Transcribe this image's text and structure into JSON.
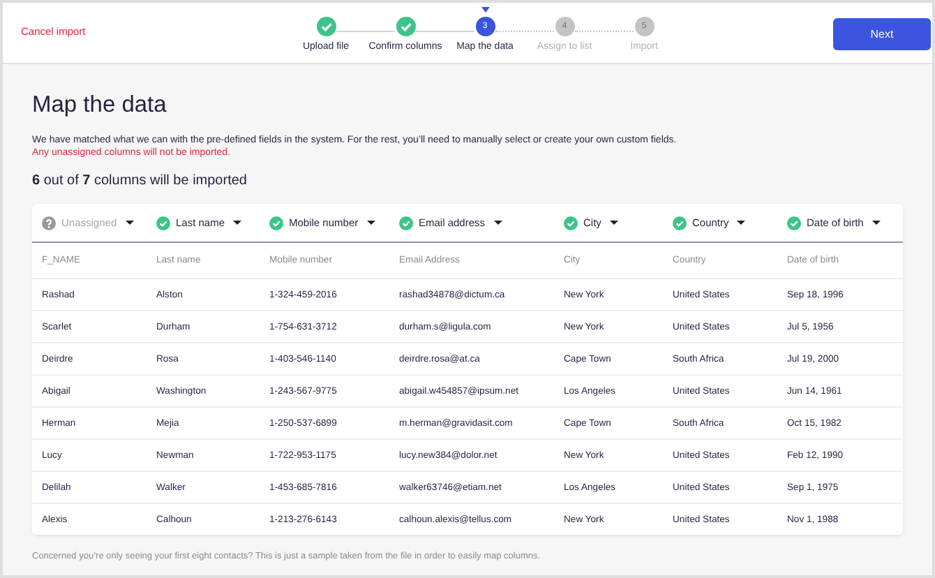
{
  "header": {
    "cancel": "Cancel import",
    "next": "Next",
    "steps": [
      {
        "label": "Upload file",
        "completed": true,
        "selected": false
      },
      {
        "label": "Confirm columns",
        "completed": true,
        "selected": false
      },
      {
        "number": "3",
        "label": "Map the data",
        "completed": false,
        "selected": true
      },
      {
        "number": "4",
        "label": "Assign to list",
        "completed": false,
        "selected": false
      },
      {
        "number": "5",
        "label": "Import",
        "completed": false,
        "selected": false
      }
    ]
  },
  "title": "Map the data",
  "description": "We have matched what we can with the pre-defined fields in the system. For the rest, you’ll need to manually select or create your own custom fields.",
  "warning": "Any unassigned columns will not be imported.",
  "summary": "**6** out of **7** columns will be imported",
  "table": {
    "columns": [
      {
        "field": "Unassigned",
        "assigned": false,
        "source": "F_NAME"
      },
      {
        "field": "Last name",
        "assigned": true,
        "source": "Last name"
      },
      {
        "field": "Mobile number",
        "assigned": true,
        "source": "Mobile number"
      },
      {
        "field": "Email address",
        "assigned": true,
        "source": "Email Address"
      },
      {
        "field": "City",
        "assigned": true,
        "source": "City"
      },
      {
        "field": "Country",
        "assigned": true,
        "source": "Country"
      },
      {
        "field": "Date of birth",
        "assigned": true,
        "source": "Date of birth"
      }
    ],
    "rows": [
      [
        "Rashad",
        "Alston",
        "1-324-459-2016",
        "rashad34878@dictum.ca",
        "New York",
        "United States",
        "Sep 18, 1996"
      ],
      [
        "Scarlet",
        "Durham",
        "1-754-631-3712",
        "durham.s@ligula.com",
        "New York",
        "United States",
        "Jul 5, 1956"
      ],
      [
        "Deirdre",
        "Rosa",
        "1-403-546-1140",
        "deirdre.rosa@at.ca",
        "Cape Town",
        "South Africa",
        "Jul 19, 2000"
      ],
      [
        "Abigail",
        "Washington",
        "1-243-567-9775",
        "abigail.w454857@ipsum.net",
        "Los Angeles",
        "United States",
        "Jun 14, 1961"
      ],
      [
        "Herman",
        "Mejia",
        "1-250-537-6899",
        "m.herman@gravidasit.com",
        "Cape Town",
        "South Africa",
        "Oct 15, 1982"
      ],
      [
        "Lucy",
        "Newman",
        "1-722-953-1175",
        "lucy.new384@dolor.net",
        "New York",
        "United States",
        "Feb 12, 1990"
      ],
      [
        "Delilah",
        "Walker",
        "1-453-685-7816",
        "walker63746@etiam.net",
        "Los Angeles",
        "United States",
        "Sep 1, 1975"
      ],
      [
        "Alexis",
        "Calhoun",
        "1-213-276-6143",
        "calhoun.alexis@tellus.com",
        "New York",
        "United States",
        "Nov 1, 1988"
      ]
    ]
  },
  "footnote": "Concerned you’re only seeing your first eight contacts? This is just a sample taken from the file in order to easily map columns."
}
